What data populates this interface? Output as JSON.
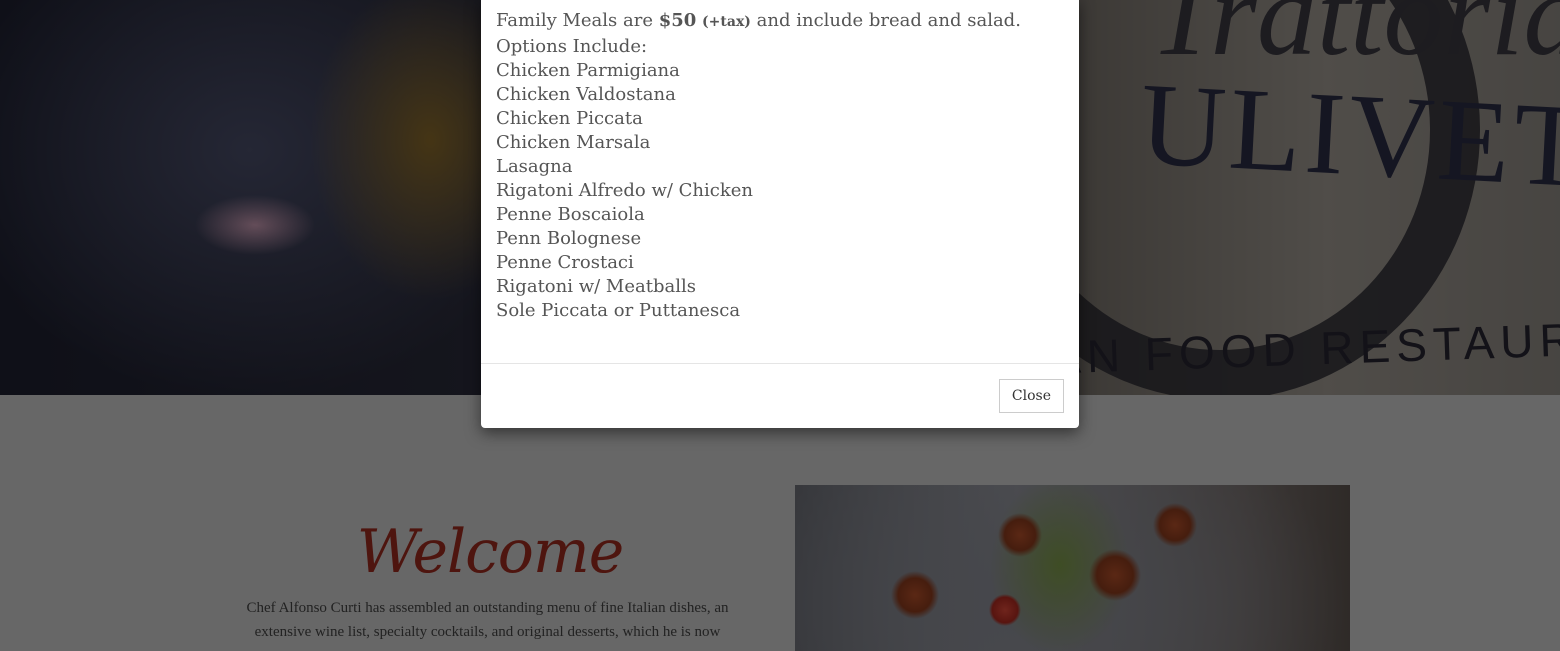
{
  "hero": {
    "sign_script": "Trattoria",
    "sign_name": "ULIVETO",
    "sign_sub": "AN FOOD RESTAURAN"
  },
  "welcome": {
    "title": "Welcome",
    "text": "Chef Alfonso Curti has assembled an outstanding menu of fine Italian dishes, an extensive wine list, specialty cocktails, and original desserts, which he is now"
  },
  "modal": {
    "intro_prefix": "Family Meals are",
    "price": "$50",
    "tax": "(+tax)",
    "intro_suffix": "and include bread and salad.",
    "options_label": "Options Include:",
    "options": [
      "Chicken Parmigiana",
      "Chicken Valdostana",
      "Chicken Piccata",
      "Chicken Marsala",
      "Lasagna",
      "Rigatoni Alfredo w/ Chicken",
      "Penne Boscaiola",
      "Penn Bolognese",
      "Penne Crostaci",
      "Rigatoni w/ Meatballs",
      "Sole Piccata or Puttanesca"
    ],
    "close_label": "Close"
  }
}
